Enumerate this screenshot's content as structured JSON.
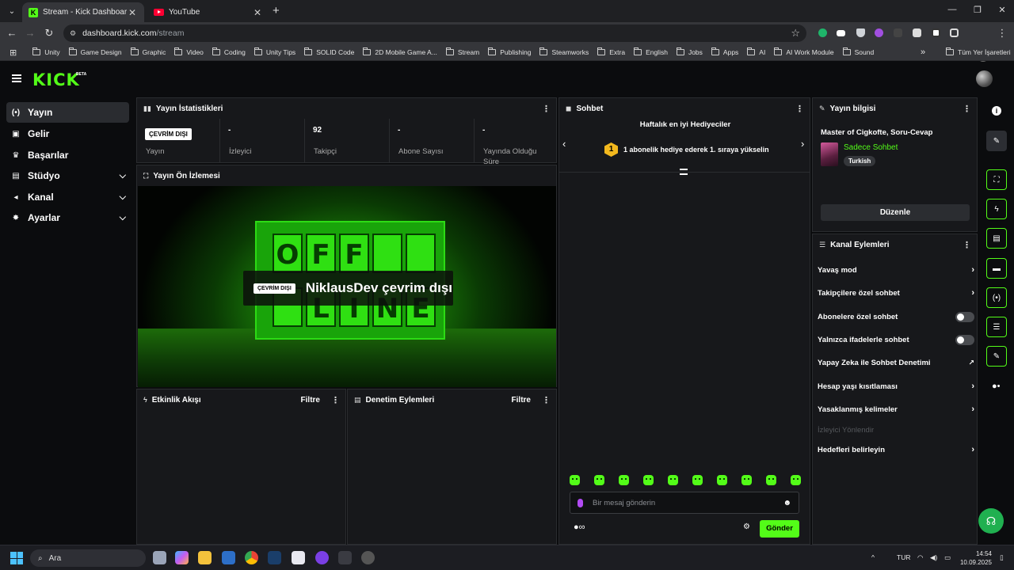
{
  "browser": {
    "tabs": [
      {
        "title": "Stream - Kick Dashboard",
        "active": true
      },
      {
        "title": "YouTube",
        "active": false
      }
    ],
    "url_host": "dashboard.kick.com",
    "url_path": "/stream",
    "bookmarks": [
      "Unity",
      "Game Design",
      "Graphic",
      "Video",
      "Coding",
      "Unity Tips",
      "SOLID Code",
      "2D Mobile Game A...",
      "Stream",
      "Publishing",
      "Steamworks",
      "Extra",
      "English",
      "Jobs",
      "Apps",
      "AI",
      "AI Work Module",
      "Sound"
    ],
    "bookmarks_more": "»",
    "all_bookmarks": "Tüm Yer İşaretleri"
  },
  "kick": {
    "logo": "KICK",
    "beta": "BETA"
  },
  "sidebar": {
    "items": [
      {
        "label": "Yayın",
        "icon": "broadcast-icon",
        "glyph": "(•)",
        "active": true,
        "expandable": false
      },
      {
        "label": "Gelir",
        "icon": "wallet-icon",
        "glyph": "▣",
        "active": false,
        "expandable": false
      },
      {
        "label": "Başarılar",
        "icon": "trophy-icon",
        "glyph": "♛",
        "active": false,
        "expandable": false
      },
      {
        "label": "Stüdyo",
        "icon": "studio-icon",
        "glyph": "▤",
        "active": false,
        "expandable": true
      },
      {
        "label": "Kanal",
        "icon": "channel-icon",
        "glyph": "◂",
        "active": false,
        "expandable": true
      },
      {
        "label": "Ayarlar",
        "icon": "settings-icon",
        "glyph": "✸",
        "active": false,
        "expandable": true
      }
    ]
  },
  "stats": {
    "title": "Yayın İstatistikleri",
    "cells": [
      {
        "value": "ÇEVRİM DIŞI",
        "label": "Yayın",
        "badge": true
      },
      {
        "value": "-",
        "label": "İzleyici",
        "badge": false
      },
      {
        "value": "92",
        "label": "Takipçi",
        "badge": false
      },
      {
        "value": "-",
        "label": "Abone Sayısı",
        "badge": false
      },
      {
        "value": "-",
        "label": "Yayında Olduğu Süre",
        "badge": false
      }
    ]
  },
  "preview": {
    "title": "Yayın Ön İzlemesi",
    "badge": "ÇEVRİM DIŞI",
    "message": "NiklausDev çevrim dışı",
    "sign_letters": [
      "O",
      "F",
      "F",
      "",
      "",
      "",
      "L",
      "I",
      "N",
      "E"
    ]
  },
  "activity": {
    "title": "Etkinlik Akışı",
    "filter": "Filtre"
  },
  "moderation": {
    "title": "Denetim Eylemleri",
    "filter": "Filtre"
  },
  "chat": {
    "title": "Sohbet",
    "weekly_title": "Haftalık en iyi Hediyeciler",
    "rank": "1",
    "rank_text": "1 abonelik hediye ederek 1. sıraya yükselin",
    "placeholder": "Bir mesaj gönderin",
    "send": "Gönder",
    "emote_count": 10
  },
  "stream_info": {
    "title": "Yayın bilgisi",
    "stream_title": "Master of Cigkofte, Soru-Cevap",
    "category": "Sadece Sohbet",
    "tag": "Turkish",
    "edit": "Düzenle"
  },
  "channel_actions": {
    "title": "Kanal Eylemleri",
    "items": [
      {
        "label": "Yavaş mod",
        "control": "chevron"
      },
      {
        "label": "Takipçilere özel sohbet",
        "control": "chevron"
      },
      {
        "label": "Abonelere özel sohbet",
        "control": "toggle",
        "on": false
      },
      {
        "label": "Yalnızca ifadelerle sohbet",
        "control": "toggle",
        "on": false
      },
      {
        "label": "Yapay Zeka ile Sohbet Denetimi",
        "control": "external"
      },
      {
        "label": "Hesap yaşı kısıtlaması",
        "control": "chevron"
      },
      {
        "label": "Yasaklanmış kelimeler",
        "control": "chevron"
      },
      {
        "label": "İzleyici Yönlendir",
        "control": "none",
        "disabled": true
      },
      {
        "label": "Hedefleri belirleyin",
        "control": "chevron"
      }
    ]
  },
  "colors": {
    "brand": "#53fc18",
    "panel": "#17181b",
    "bg": "#0b0c0e"
  },
  "taskbar": {
    "search": "Ara",
    "lang": "TUR",
    "time": "14:54",
    "date": "10.09.2025"
  }
}
